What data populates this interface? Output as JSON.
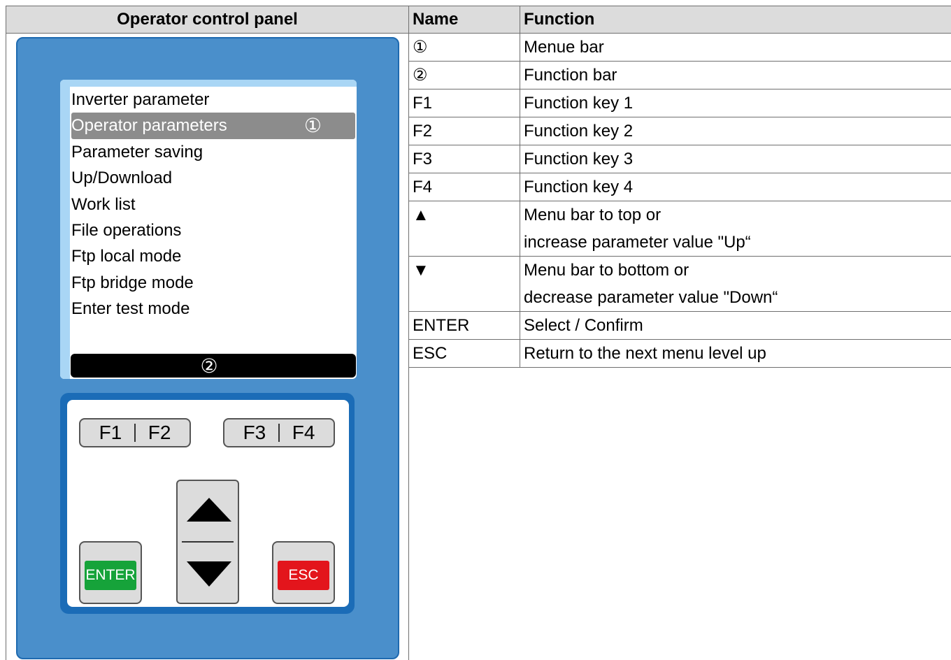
{
  "left_header": "Operator control panel",
  "display": {
    "menu_items": [
      "Inverter parameter",
      "Operator parameters",
      "Parameter saving",
      "Up/Download",
      "Work list",
      "File operations",
      "Ftp local mode",
      "Ftp bridge mode",
      "Enter test mode"
    ],
    "selected_index": 1,
    "selected_marker": "①",
    "function_bar_marker": "②"
  },
  "keypad": {
    "f1": "F1",
    "f2": "F2",
    "f3": "F3",
    "f4": "F4",
    "enter": "ENTER",
    "esc": "ESC",
    "up_icon": "arrow-up",
    "down_icon": "arrow-down"
  },
  "colors": {
    "panel": "#4a8fcb",
    "keypad": "#1b6cb7",
    "enter": "#16a33a",
    "esc": "#e3151c",
    "selected_row": "#8c8c8c"
  },
  "table": {
    "headers": [
      "Name",
      "Function"
    ],
    "rows": [
      {
        "name": "①",
        "function": [
          "Menue bar"
        ]
      },
      {
        "name": "②",
        "function": [
          "Function bar"
        ]
      },
      {
        "name": "F1",
        "function": [
          "Function key 1"
        ]
      },
      {
        "name": "F2",
        "function": [
          "Function key 2"
        ]
      },
      {
        "name": "F3",
        "function": [
          "Function key 3"
        ]
      },
      {
        "name": "F4",
        "function": [
          "Function key 4"
        ]
      },
      {
        "name": "▲",
        "function": [
          "Menu bar to top or",
          "increase parameter value \"Up“"
        ]
      },
      {
        "name": "▼",
        "function": [
          "Menu bar to bottom or",
          "decrease parameter value \"Down“"
        ]
      },
      {
        "name": "ENTER",
        "function": [
          "Select / Confirm"
        ]
      },
      {
        "name": "ESC",
        "function": [
          "Return to the next menu level up"
        ]
      }
    ]
  }
}
